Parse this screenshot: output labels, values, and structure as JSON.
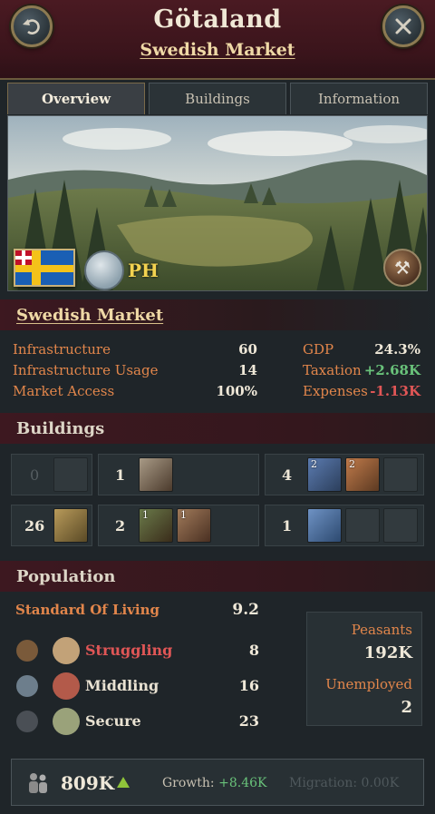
{
  "header": {
    "title": "Götaland",
    "subtitle": "Swedish Market"
  },
  "tabs": [
    {
      "label": "Overview",
      "active": true
    },
    {
      "label": "Buildings",
      "active": false
    },
    {
      "label": "Information",
      "active": false
    }
  ],
  "banner": {
    "ph_label": "PH"
  },
  "market": {
    "name": "Swedish Market",
    "stats_left": [
      {
        "label": "Infrastructure",
        "value": "60"
      },
      {
        "label": "Infrastructure Usage",
        "value": "14"
      },
      {
        "label": "Market Access",
        "value": "100%"
      }
    ],
    "stats_right": [
      {
        "label": "GDP",
        "value": "24.3%",
        "color": "neutral"
      },
      {
        "label": "Taxation",
        "value": "+2.68K",
        "color": "green"
      },
      {
        "label": "Expenses",
        "value": "-1.13K",
        "color": "red"
      }
    ]
  },
  "buildings": {
    "title": "Buildings",
    "groups": [
      {
        "count": "0"
      },
      {
        "count": "1"
      },
      {
        "count": "4",
        "badges": [
          "2",
          "2"
        ]
      },
      {
        "count": "26"
      },
      {
        "count": "2",
        "badges": [
          "1",
          "1"
        ]
      },
      {
        "count": "1"
      }
    ]
  },
  "population": {
    "title": "Population",
    "sol_label": "Standard Of Living",
    "sol_value": "9.2",
    "rows": [
      {
        "label": "Struggling",
        "value": "8"
      },
      {
        "label": "Middling",
        "value": "16"
      },
      {
        "label": "Secure",
        "value": "23"
      }
    ],
    "peasants_label": "Peasants",
    "peasants_value": "192K",
    "unemployed_label": "Unemployed",
    "unemployed_value": "2"
  },
  "footer": {
    "total": "809K",
    "growth_label": "Growth:",
    "growth_value": "+8.46K",
    "migration_label": "Migration:",
    "migration_value": "0.00K"
  },
  "colors": {
    "accent_orange": "#e2864b",
    "positive": "#69c27a",
    "negative": "#e05656",
    "header_red": "#4a1a22"
  }
}
